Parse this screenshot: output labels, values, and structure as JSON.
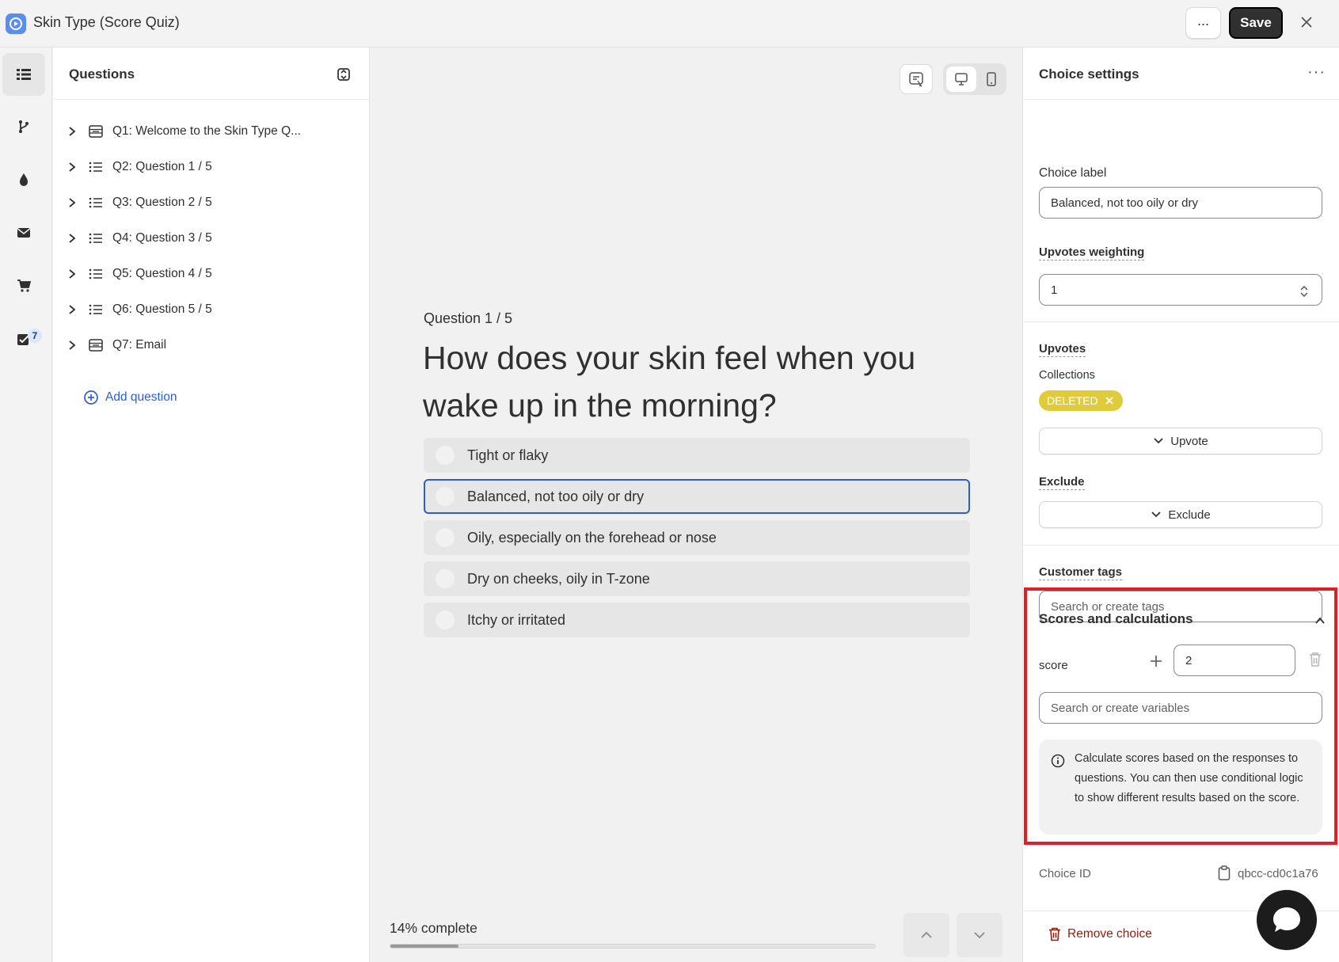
{
  "app": {
    "title": "Skin Type (Score Quiz)"
  },
  "header": {
    "more_label": "...",
    "save_label": "Save"
  },
  "rail": {
    "badge_count": "7"
  },
  "questions_panel": {
    "title": "Questions",
    "items": [
      {
        "label": "Q1: Welcome to the Skin Type Q...",
        "icon": "form-icon"
      },
      {
        "label": "Q2: Question 1 / 5",
        "icon": "list-icon"
      },
      {
        "label": "Q3: Question 2 / 5",
        "icon": "list-icon"
      },
      {
        "label": "Q4: Question 3 / 5",
        "icon": "list-icon"
      },
      {
        "label": "Q5: Question 4 / 5",
        "icon": "list-icon"
      },
      {
        "label": "Q6: Question 5 / 5",
        "icon": "list-icon"
      },
      {
        "label": "Q7: Email",
        "icon": "form-icon"
      }
    ],
    "add_label": "Add question"
  },
  "preview": {
    "eyebrow": "Question 1 / 5",
    "heading": "How does your skin feel when you wake up in the morning?",
    "choices": [
      {
        "label": "Tight or flaky",
        "selected": false
      },
      {
        "label": "Balanced, not too oily or dry",
        "selected": true
      },
      {
        "label": "Oily, especially on the forehead or nose",
        "selected": false
      },
      {
        "label": "Dry on cheeks, oily in T-zone",
        "selected": false
      },
      {
        "label": "Itchy or irritated",
        "selected": false
      }
    ],
    "progress_label": "14% complete",
    "progress_value": 0.14
  },
  "settings": {
    "title": "Choice settings",
    "menu_label": "···",
    "choice_label": {
      "label": "Choice label",
      "value": "Balanced, not too oily or dry"
    },
    "upvotes_weighting": {
      "label": "Upvotes weighting",
      "value": "1"
    },
    "upvotes": {
      "label": "Upvotes",
      "collections_label": "Collections",
      "tag": "DELETED",
      "button": "Upvote"
    },
    "exclude": {
      "label": "Exclude",
      "button": "Exclude"
    },
    "customer_tags": {
      "label": "Customer tags",
      "placeholder": "Search or create tags"
    },
    "scores": {
      "title": "Scores and calculations",
      "variable_name": "score",
      "variable_value": "2",
      "search_placeholder": "Search or create variables",
      "info": "Calculate scores based on the responses to questions. You can then use conditional logic to show different results based on the score."
    },
    "choice_id": {
      "label": "Choice ID",
      "value": "qbcc-cd0c1a76"
    },
    "remove_label": "Remove choice"
  },
  "colors": {
    "accent": "#2b5fd9",
    "highlight": "#e01f26",
    "tag": "#e0cc3a",
    "danger": "#8e1f0b"
  }
}
